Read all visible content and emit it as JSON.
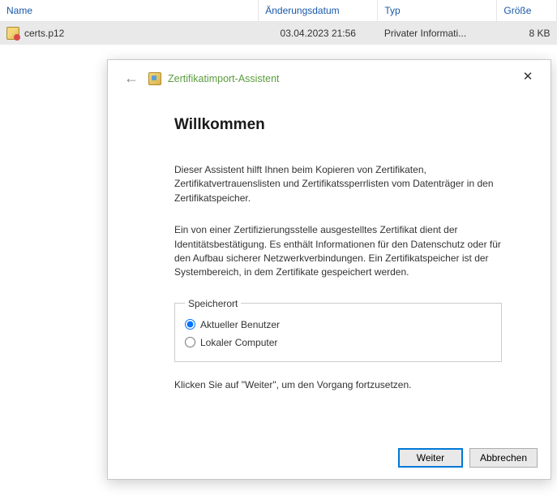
{
  "columns": {
    "name": "Name",
    "date": "Änderungsdatum",
    "type": "Typ",
    "size": "Größe"
  },
  "files": [
    {
      "name": "certs.p12",
      "date": "03.04.2023 21:56",
      "type": "Privater Informati...",
      "size": "8 KB"
    }
  ],
  "dialog": {
    "title": "Zertifikatimport-Assistent",
    "heading": "Willkommen",
    "intro": "Dieser Assistent hilft Ihnen beim Kopieren von Zertifikaten, Zertifikatvertrauenslisten und Zertifikatssperrlisten vom Datenträger in den Zertifikatspeicher.",
    "explain": "Ein von einer Zertifizierungsstelle ausgestelltes Zertifikat dient der Identitätsbestätigung. Es enthält Informationen für den Datenschutz oder für den Aufbau sicherer Netzwerkverbindungen. Ein Zertifikatspeicher ist der Systembereich, in dem Zertifikate gespeichert werden.",
    "storage_legend": "Speicherort",
    "radio_current_user": "Aktueller Benutzer",
    "radio_local_computer": "Lokaler Computer",
    "continue_hint": "Klicken Sie auf \"Weiter\", um den Vorgang fortzusetzen.",
    "next": "Weiter",
    "cancel": "Abbrechen"
  }
}
